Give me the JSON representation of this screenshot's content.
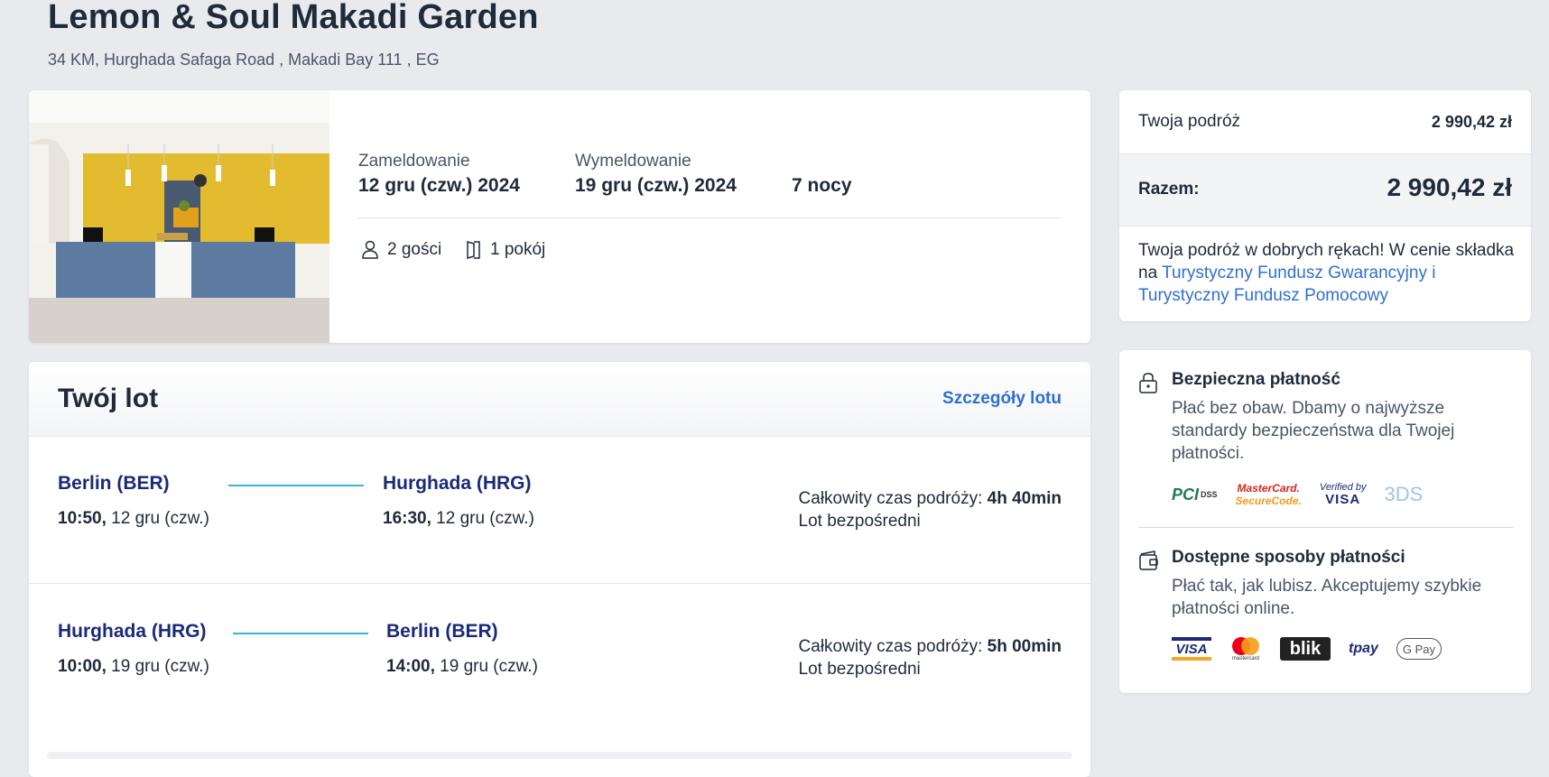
{
  "hotel": {
    "name": "Lemon & Soul Makadi Garden",
    "address": "34 KM, Hurghada Safaga Road , Makadi Bay 111 , EG"
  },
  "stay": {
    "checkin_label": "Zameldowanie",
    "checkin_value": "12 gru (czw.) 2024",
    "checkout_label": "Wymeldowanie",
    "checkout_value": "19 gru (czw.) 2024",
    "nights": "7 nocy",
    "guests": "2 gości",
    "rooms": "1 pokój"
  },
  "flight": {
    "title": "Twój lot",
    "details_link": "Szczegóły lotu",
    "legs": [
      {
        "from_city": "Berlin (BER)",
        "from_time": "10:50,",
        "from_date": "12 gru (czw.)",
        "to_city": "Hurghada (HRG)",
        "to_time": "16:30,",
        "to_date": "12 gru (czw.)",
        "duration_label": "Całkowity czas podróży:",
        "duration_value": "4h 40min",
        "type": "Lot bezpośredni"
      },
      {
        "from_city": "Hurghada (HRG)",
        "from_time": "10:00,",
        "from_date": "19 gru (czw.)",
        "to_city": "Berlin (BER)",
        "to_time": "14:00,",
        "to_date": "19 gru (czw.)",
        "duration_label": "Całkowity czas podróży:",
        "duration_value": "5h 00min",
        "type": "Lot bezpośredni"
      }
    ]
  },
  "summary": {
    "trip_label": "Twoja podróż",
    "trip_value": "2 990,42 zł",
    "total_label": "Razem:",
    "total_value": "2 990,42 zł",
    "note_text": "Twoja podróż w dobrych rękach! W cenie składka na ",
    "note_link": "Turystyczny Fundusz Gwarancyjny i Turystyczny Fundusz Pomocowy"
  },
  "payment": {
    "secure_title": "Bezpieczna płatność",
    "secure_desc": "Płać bez obaw. Dbamy o najwyższe standardy bezpieczeństwa dla Twojej płatności.",
    "secure_logos": {
      "pci": "PCI",
      "pci_dss": "DSS",
      "mastercard_line1": "MasterCard.",
      "mastercard_line2": "SecureCode.",
      "verified_by": "Verified by",
      "verified_visa": "VISA",
      "threeds": "3DS"
    },
    "methods_title": "Dostępne sposoby płatności",
    "methods_desc": "Płać tak, jak lubisz. Akceptujemy szybkie płatności online.",
    "method_logos": {
      "visa": "VISA",
      "mastercard_caption": "mastercard",
      "blik": "blik",
      "tpay": "tpay",
      "gpay": "G Pay"
    }
  },
  "colors": {
    "accent_link": "#2f6fd1",
    "city_text": "#1a2a78",
    "route_line": "#33b6d6"
  }
}
